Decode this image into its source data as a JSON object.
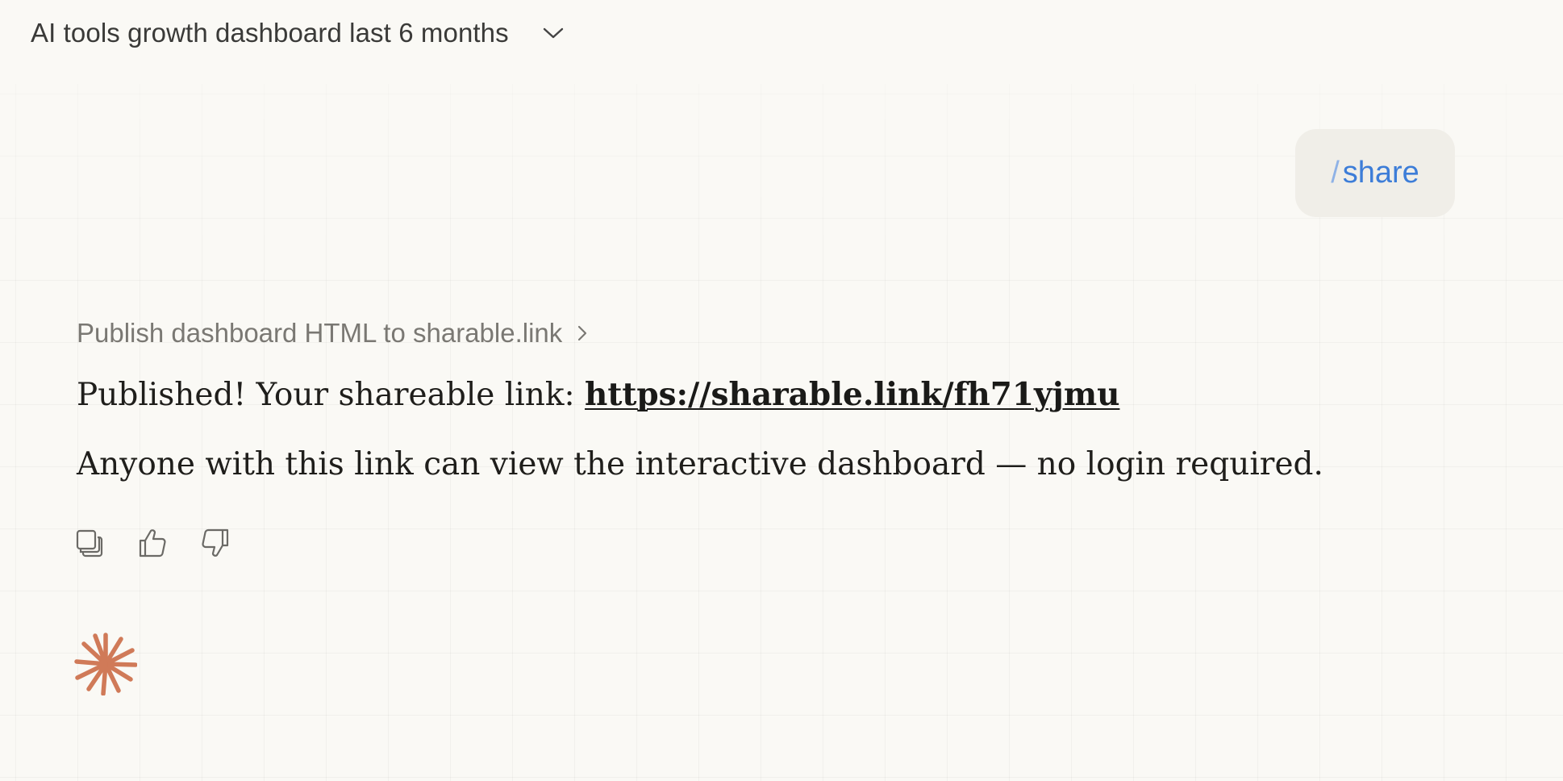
{
  "header": {
    "title": "AI tools growth dashboard last 6 months",
    "dropdown_icon": "chevron-down-icon"
  },
  "user_message": {
    "slash": "/",
    "command": "share"
  },
  "assistant": {
    "tool_call_label": "Publish dashboard HTML to sharable.link",
    "published_prefix": "Published! Your shareable link: ",
    "link_url": "https://sharable.link/fh71yjmu",
    "note": "Anyone with this link can view the interactive dashboard — no login required.",
    "actions": [
      "copy-icon",
      "thumbs-up-icon",
      "thumbs-down-icon"
    ]
  },
  "colors": {
    "background": "#faf9f5",
    "bubble": "#f0eee8",
    "command_blue": "#3d7dd8",
    "spark_orange": "#d07a58"
  }
}
